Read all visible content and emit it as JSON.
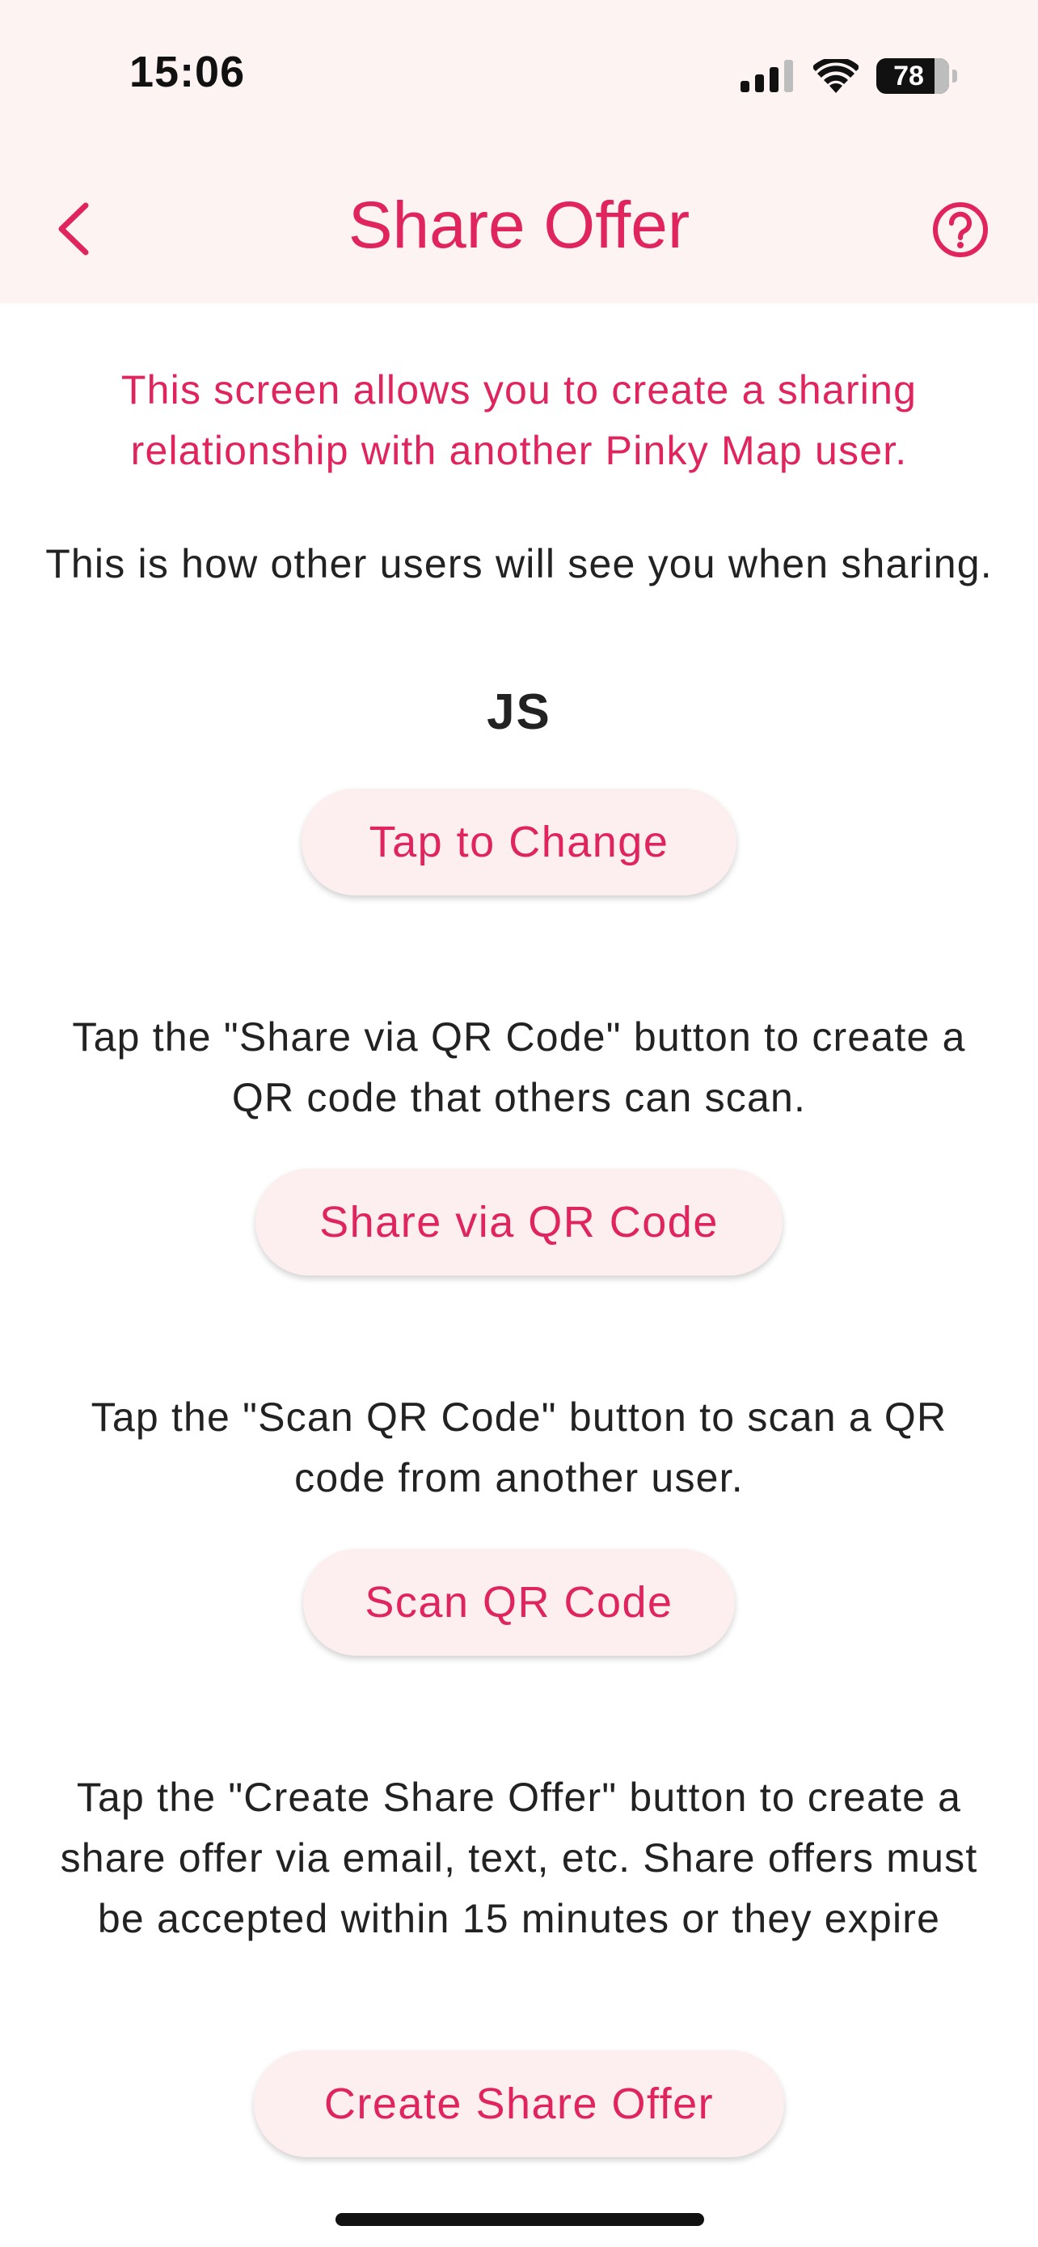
{
  "status_bar": {
    "time": "15:06",
    "battery_level": "78",
    "icons": [
      "cellular-signal-icon",
      "wifi-icon",
      "battery-icon"
    ]
  },
  "app_bar": {
    "title": "Share Offer",
    "back_icon": "chevron-left-icon",
    "help_icon": "help-circle-icon"
  },
  "content": {
    "intro": "This screen allows you to create a sharing relationship with another Pinky Map user.",
    "appearance_text": "This is how other users will see you when sharing.",
    "initials": "JS",
    "tap_to_change_label": "Tap to Change",
    "qr_share_text": "Tap the \"Share via QR Code\" button to create a QR code that others can scan.",
    "qr_share_label": "Share via QR Code",
    "qr_scan_text": "Tap the \"Scan QR Code\" button to scan a QR code from another user.",
    "qr_scan_label": "Scan QR Code",
    "share_offer_text": "Tap the \"Create Share Offer\" button to create a share offer via email, text, etc. Share offers must be accepted within 15 minutes or they expire",
    "share_offer_label": "Create Share Offer"
  },
  "colors": {
    "accent": "#e0245e",
    "header_bg": "#fdf3f2",
    "button_bg": "#fdeef0",
    "text": "#222222"
  }
}
